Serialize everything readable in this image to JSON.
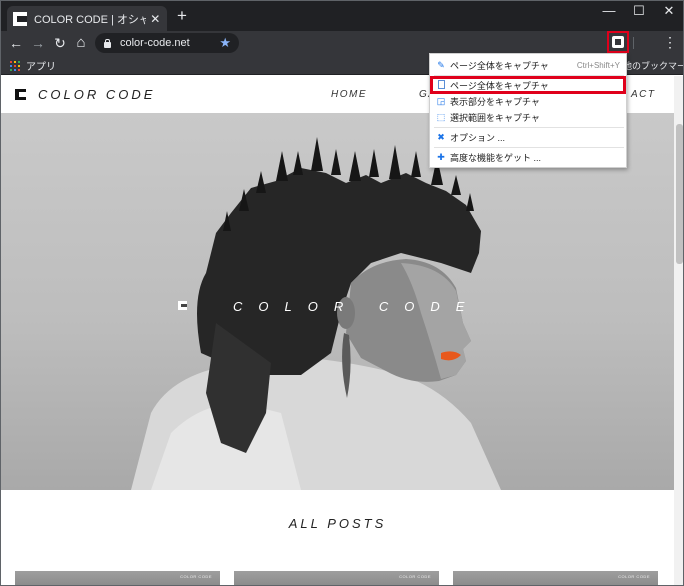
{
  "tab": {
    "title": "COLOR CODE | オシャレなもの好きな",
    "close": "✕"
  },
  "newtab": "+",
  "window_controls": {
    "minimize": "—",
    "maximize": "☐",
    "close": "✕"
  },
  "toolbar": {
    "back": "←",
    "forward": "→",
    "reload": "↻",
    "home": "⌂",
    "url": "color-code.net",
    "star": "★",
    "menu": "⋮"
  },
  "bookmarks": {
    "apps": "アプリ",
    "other": "他のブックマーク",
    "apps_colors": [
      "#ea4335",
      "#fbbc05",
      "#34a853",
      "#4285f4",
      "#ea4335",
      "#fbbc05",
      "#34a853",
      "#4285f4",
      "#ea4335"
    ]
  },
  "site": {
    "logo": "COLOR CODE",
    "nav": [
      "HOME",
      "GA",
      "ACT"
    ],
    "hero_title": "COLOR CODE",
    "section_title": "ALL POSTS",
    "card_label": "COLOR CODE"
  },
  "menu": {
    "items": [
      {
        "icon": "brush-icon",
        "glyph": "✎",
        "label": "ページ全体をキャプチャ",
        "shortcut": "Ctrl+Shift+Y"
      },
      {
        "icon": "document-icon",
        "glyph": "",
        "label": "ページ全体をキャプチャ",
        "shortcut": ""
      },
      {
        "icon": "visible-area-icon",
        "glyph": "◲",
        "label": "表示部分をキャプチャ",
        "shortcut": ""
      },
      {
        "icon": "select-area-icon",
        "glyph": "⬚",
        "label": "選択範囲をキャプチャ",
        "shortcut": ""
      },
      {
        "icon": "wrench-icon",
        "glyph": "✖",
        "label": "オプション ...",
        "shortcut": ""
      },
      {
        "icon": "plus-icon",
        "glyph": "✚",
        "label": "高度な機能をゲット ...",
        "shortcut": ""
      }
    ]
  },
  "colors": {
    "highlight": "#e0001b",
    "accent": "#1a73e8"
  }
}
